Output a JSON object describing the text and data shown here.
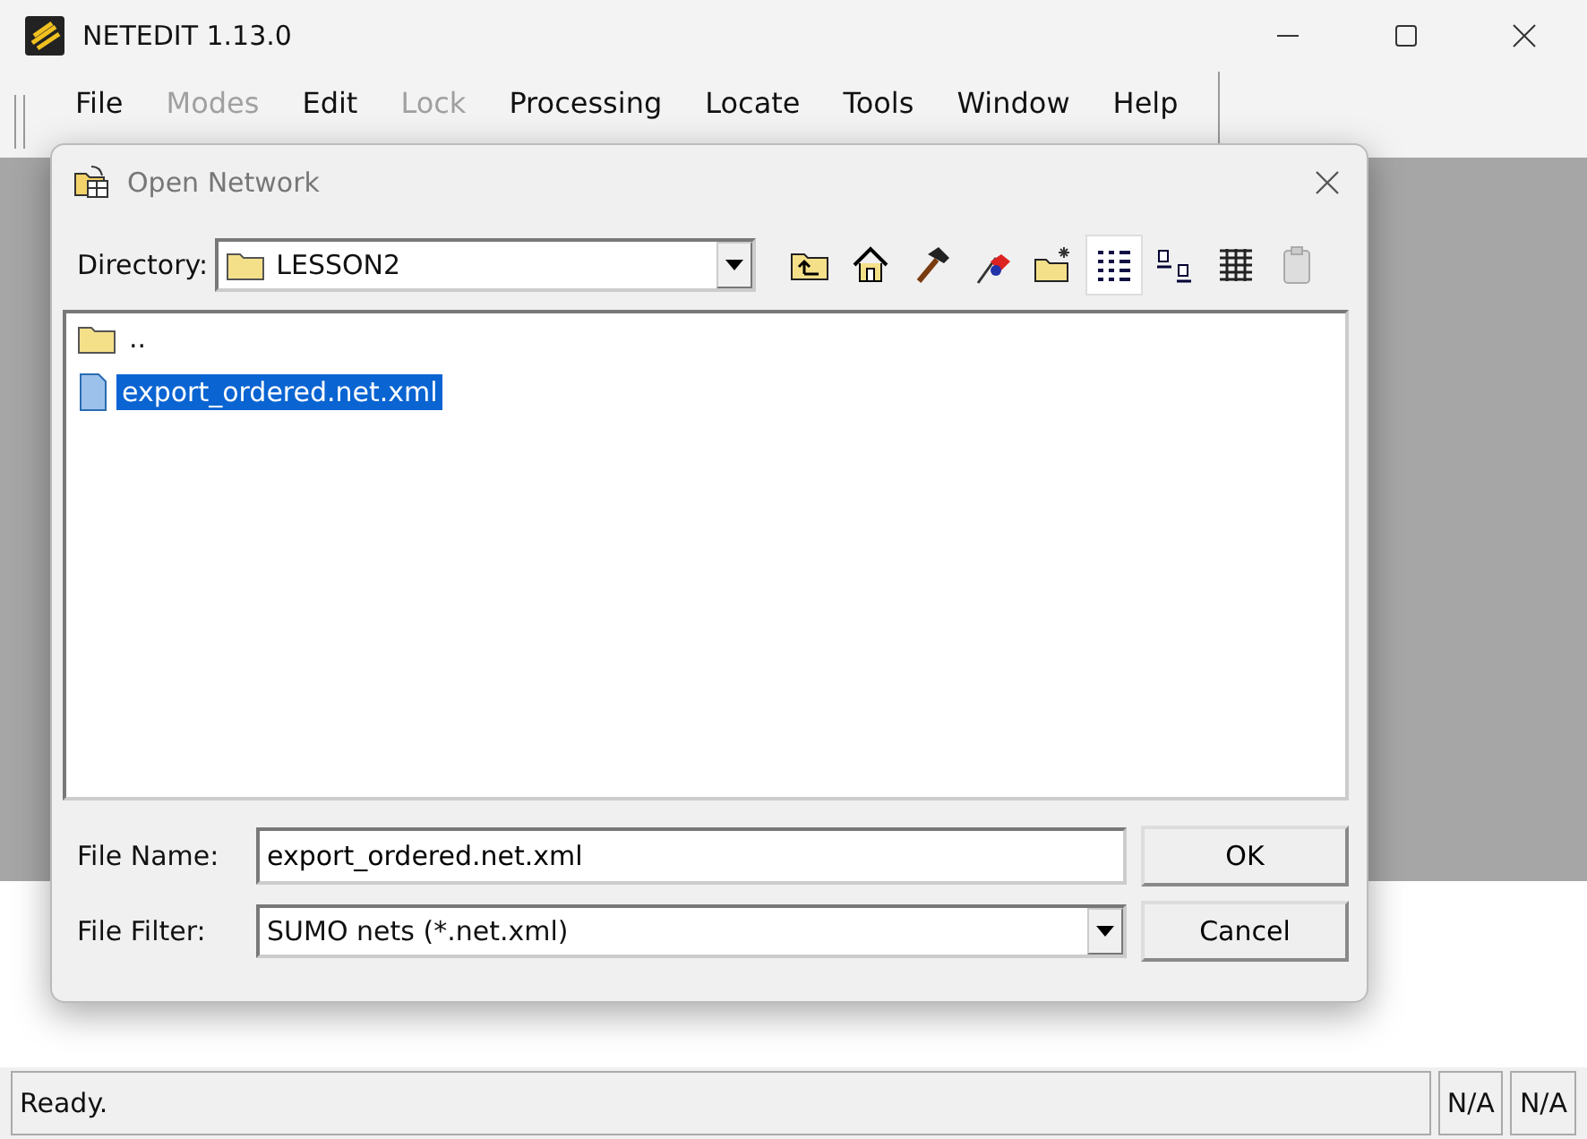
{
  "window": {
    "title": "NETEDIT 1.13.0"
  },
  "menu": [
    {
      "label": "File",
      "disabled": false
    },
    {
      "label": "Modes",
      "disabled": true
    },
    {
      "label": "Edit",
      "disabled": false
    },
    {
      "label": "Lock",
      "disabled": true
    },
    {
      "label": "Processing",
      "disabled": false
    },
    {
      "label": "Locate",
      "disabled": false
    },
    {
      "label": "Tools",
      "disabled": false
    },
    {
      "label": "Window",
      "disabled": false
    },
    {
      "label": "Help",
      "disabled": false
    }
  ],
  "dialog": {
    "title": "Open Network",
    "directory_label": "Directory:",
    "directory": "LESSON2",
    "toolbar": [
      {
        "kind": "up",
        "selected": false
      },
      {
        "kind": "home",
        "selected": false
      },
      {
        "kind": "hammer",
        "selected": false
      },
      {
        "kind": "flag",
        "selected": false
      },
      {
        "kind": "newfolder",
        "selected": false
      },
      {
        "kind": "details",
        "selected": true
      },
      {
        "kind": "icons",
        "selected": false
      },
      {
        "kind": "list",
        "selected": false
      },
      {
        "kind": "clipboard",
        "selected": false
      }
    ],
    "files": [
      {
        "kind": "folder",
        "name": "..",
        "selected": false
      },
      {
        "kind": "file",
        "name": "export_ordered.net.xml",
        "selected": true
      }
    ],
    "file_name_label": "File Name:",
    "file_name": "export_ordered.net.xml",
    "file_filter_label": "File Filter:",
    "file_filter": "SUMO nets (*.net.xml)",
    "buttons": [
      "OK",
      "Cancel"
    ]
  },
  "status_bar": {
    "message": "Ready.",
    "fields": [
      "N/A",
      "N/A"
    ]
  }
}
